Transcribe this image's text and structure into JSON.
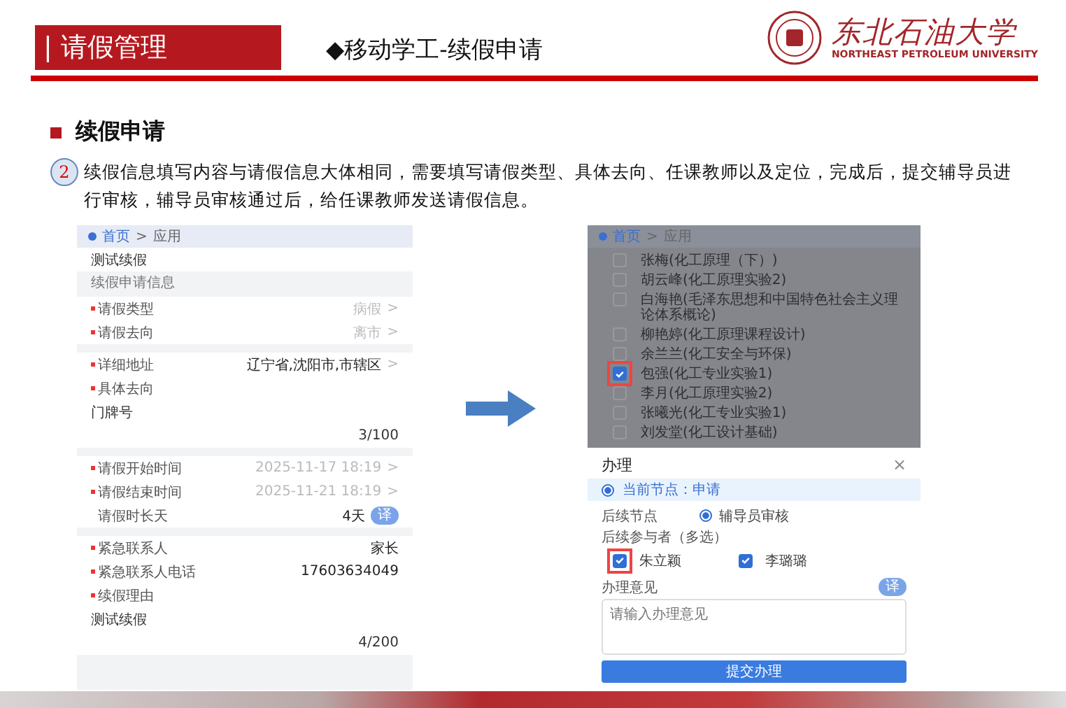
{
  "header": {
    "section": "| 请假管理",
    "title": "◆移动学工-续假申请",
    "logo_name": "东北石油大学",
    "logo_english": "NORTHEAST PETROLEUM UNIVERSITY"
  },
  "heading": "续假申请",
  "step": {
    "number": "2",
    "text": "续假信息填写内容与请假信息大体相同，需要填写请假类型、具体去向、任课教师以及定位，完成后，提交辅导员进行审核，辅导员审核通过后，给任课教师发送请假信息。"
  },
  "left_phone": {
    "breadcrumb": [
      "首页",
      ">",
      "应用"
    ],
    "rows": [
      {
        "kind": "value",
        "label": "测试续假"
      },
      {
        "kind": "section",
        "label": "续假申请信息"
      },
      {
        "kind": "field",
        "label": "请假类型",
        "required": true,
        "value": "病假",
        "arrow": ">",
        "muted": true
      },
      {
        "kind": "field",
        "label": "请假去向",
        "required": true,
        "value": "离市",
        "arrow": ">",
        "muted": true
      },
      {
        "kind": "gap"
      },
      {
        "kind": "field",
        "label": "详细地址",
        "required": true,
        "value": "辽宁省,沈阳市,市辖区",
        "arrow": ">",
        "muted": false
      },
      {
        "kind": "label",
        "label": "具体去向",
        "required": true
      },
      {
        "kind": "value",
        "label": "门牌号"
      },
      {
        "kind": "count",
        "label": "3/100"
      },
      {
        "kind": "gap"
      },
      {
        "kind": "field",
        "label": "请假开始时间",
        "required": true,
        "value": "2025-11-17 18:19",
        "arrow": ">",
        "muted": true
      },
      {
        "kind": "field",
        "label": "请假结束时间",
        "required": true,
        "value": "2025-11-21 18:19",
        "arrow": ">",
        "muted": true
      },
      {
        "kind": "field",
        "label": "请假时长天",
        "required": false,
        "value": "4天",
        "muted": false,
        "badge": "译"
      },
      {
        "kind": "gap"
      },
      {
        "kind": "field",
        "label": "紧急联系人",
        "required": true,
        "value": "家长",
        "muted": false
      },
      {
        "kind": "field",
        "label": "紧急联系人电话",
        "required": true,
        "value": "17603634049",
        "muted": false
      },
      {
        "kind": "label",
        "label": "续假理由",
        "required": true
      },
      {
        "kind": "value",
        "label": "测试续假"
      },
      {
        "kind": "count",
        "label": "4/200"
      }
    ]
  },
  "right_phone": {
    "breadcrumb": [
      "首页",
      ">",
      "应用"
    ],
    "teachers": [
      {
        "name": "张梅(化工原理（下）)",
        "checked": false,
        "highlighted": false
      },
      {
        "name": "胡云峰(化工原理实验2)",
        "checked": false,
        "highlighted": false
      },
      {
        "name": "白海艳(毛泽东思想和中国特色社会主义理论体系概论)",
        "checked": false,
        "highlighted": false
      },
      {
        "name": "柳艳婷(化工原理课程设计)",
        "checked": false,
        "highlighted": false
      },
      {
        "name": "余兰兰(化工安全与环保)",
        "checked": false,
        "highlighted": false
      },
      {
        "name": "包强(化工专业实验1)",
        "checked": true,
        "highlighted": true
      },
      {
        "name": "李月(化工原理实验2)",
        "checked": false,
        "highlighted": false
      },
      {
        "name": "张曦光(化工专业实验1)",
        "checked": false,
        "highlighted": false
      },
      {
        "name": "刘发堂(化工设计基础)",
        "checked": false,
        "highlighted": false
      }
    ],
    "dialog": {
      "title": "办理",
      "close": "×",
      "current_node": "当前节点：申请",
      "next_label": "后续节点",
      "next_options": [
        {
          "label": "辅导员审核",
          "selected": true
        }
      ],
      "participants_label": "后续参与者（多选）",
      "participants": [
        {
          "name": "朱立颖",
          "checked": true,
          "highlighted": true
        },
        {
          "name": "李璐璐",
          "checked": true,
          "highlighted": false
        }
      ],
      "opinion_label": "办理意见",
      "badge": "译",
      "placeholder": "请输入办理意见",
      "submit": "提交办理"
    }
  }
}
